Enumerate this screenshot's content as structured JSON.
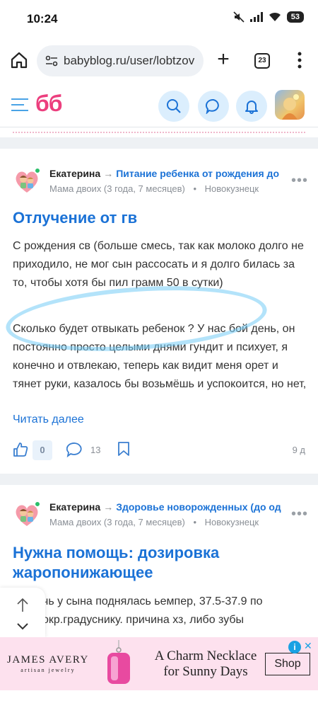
{
  "status_bar": {
    "time": "10:24",
    "battery": "53",
    "icons": [
      "mute-icon",
      "signal-icon",
      "wifi-icon",
      "battery-icon"
    ]
  },
  "browser": {
    "url": "babyblog.ru/user/lobtzov",
    "tab_count": "23",
    "icons": [
      "home-icon",
      "site-info-icon",
      "new-tab-icon",
      "tabs-icon",
      "menu-icon"
    ]
  },
  "site_header": {
    "logo": "бб",
    "accent_color": "#ec3f7e",
    "link_color": "#1b72d6",
    "icons": [
      "hamburger-icon",
      "search-icon",
      "chat-icon",
      "bell-icon"
    ]
  },
  "posts": [
    {
      "author": "Екатерина",
      "arrow": "→",
      "community": "Питание ребенка от рождения до",
      "meta": "Мама двоих (3 года, 7 месяцев)",
      "meta_sep": "•",
      "city": "Новокузнецк",
      "more": "•••",
      "title": "Отлучение от гв",
      "paragraphs": [
        "С рождения св (больше смесь, так как молоко долго не приходило, не мог сын рассосать и я долго билась за то, чтобы хотя бы пил грамм 50 в сутки)",
        "Сколько будет отвыкать ребенок ? У нас бой день, он постоянно просто целыми днями гундит и психует, я конечно и отвлекаю, теперь как видит меня орет и тянет руки, казалось бы возьмёшь и успокоится, но нет,"
      ],
      "read_more": "Читать далее",
      "likes": "0",
      "comments": "13",
      "age": "9 д"
    },
    {
      "author": "Екатерина",
      "arrow": "→",
      "community": "Здоровье новорожденных (до од",
      "meta": "Мама двоих (3 года, 7 месяцев)",
      "meta_sep": "•",
      "city": "Новокузнецк",
      "more": "•••",
      "title": "Нужна помощь: дозировка жаропонижающее",
      "paragraphs": [
        "чь у сына поднялась ьемпер, 37.5-37.9 по окр.градуснику. причина хз, либо зубы"
      ]
    }
  ],
  "ad": {
    "brand": "JAMES AVERY",
    "brand_sub": "artisan jewelry",
    "headline": "A Charm Necklace for Sunny Days",
    "cta": "Shop",
    "info": "i",
    "close": "✕"
  }
}
